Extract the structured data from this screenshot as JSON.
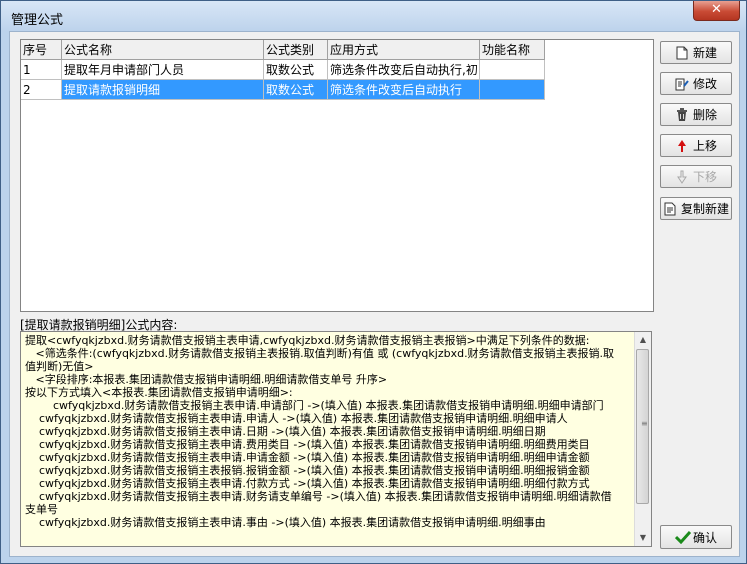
{
  "window": {
    "title": "管理公式",
    "close_glyph": "✕"
  },
  "grid": {
    "columns": [
      "序号",
      "公式名称",
      "公式类别",
      "应用方式",
      "功能名称"
    ],
    "rows": [
      [
        "1",
        "提取年月申请部门人员",
        "取数公式",
        "筛选条件改变后自动执行,初",
        ""
      ],
      [
        "2",
        "提取请款报销明细",
        "取数公式",
        "筛选条件改变后自动执行",
        ""
      ]
    ],
    "selected_row": 2
  },
  "buttons": {
    "new": "新建",
    "edit": "修改",
    "delete": "删除",
    "up": "上移",
    "down": "下移",
    "copy_new": "复制新建",
    "ok": "确认"
  },
  "content_label": "[提取请款报销明细]公式内容:",
  "formula_text": "提取<cwfyqkjzbxd.财务请款借支报销主表申请,cwfyqkjzbxd.财务请款借支报销主表报销>中满足下列条件的数据:\n   <筛选条件:(cwfyqkjzbxd.财务请款借支报销主表报销.取值判断)有值 或 (cwfyqkjzbxd.财务请款借支报销主表报销.取值判断)无值>\n   <字段排序:本报表.集团请款借支报销申请明细.明细请款借支单号 升序>\n按以下方式填入<本报表.集团请款借支报销申请明细>:\n        cwfyqkjzbxd.财务请款借支报销主表申请.申请部门 ->(填入值) 本报表.集团请款借支报销申请明细.明细申请部门\n    cwfyqkjzbxd.财务请款借支报销主表申请.申请人 ->(填入值) 本报表.集团请款借支报销申请明细.明细申请人\n    cwfyqkjzbxd.财务请款借支报销主表申请.日期 ->(填入值) 本报表.集团请款借支报销申请明细.明细日期\n    cwfyqkjzbxd.财务请款借支报销主表申请.费用类目 ->(填入值) 本报表.集团请款借支报销申请明细.明细费用类目\n    cwfyqkjzbxd.财务请款借支报销主表申请.申请金额 ->(填入值) 本报表.集团请款借支报销申请明细.明细申请金额\n    cwfyqkjzbxd.财务请款借支报销主表报销.报销金额 ->(填入值) 本报表.集团请款借支报销申请明细.明细报销金额\n    cwfyqkjzbxd.财务请款借支报销主表申请.付款方式 ->(填入值) 本报表.集团请款借支报销申请明细.明细付款方式\n    cwfyqkjzbxd.财务请款借支报销主表申请.财务请支单编号 ->(填入值) 本报表.集团请款借支报销申请明细.明细请款借支单号\n    cwfyqkjzbxd.财务请款借支报销主表申请.事由 ->(填入值) 本报表.集团请款借支报销申请明细.明细事由",
  "icons": {
    "new": "new-document-icon",
    "edit": "edit-document-icon",
    "delete": "trash-icon",
    "up": "arrow-up-icon",
    "down": "arrow-down-icon",
    "copy_new": "copy-document-icon",
    "ok": "checkmark-icon"
  },
  "colors": {
    "selection": "#3399ff",
    "memo_background": "#ffffe1",
    "close_button": "#c94b35",
    "ok_check": "#1a8a1a",
    "up_arrow": "#d41010"
  }
}
